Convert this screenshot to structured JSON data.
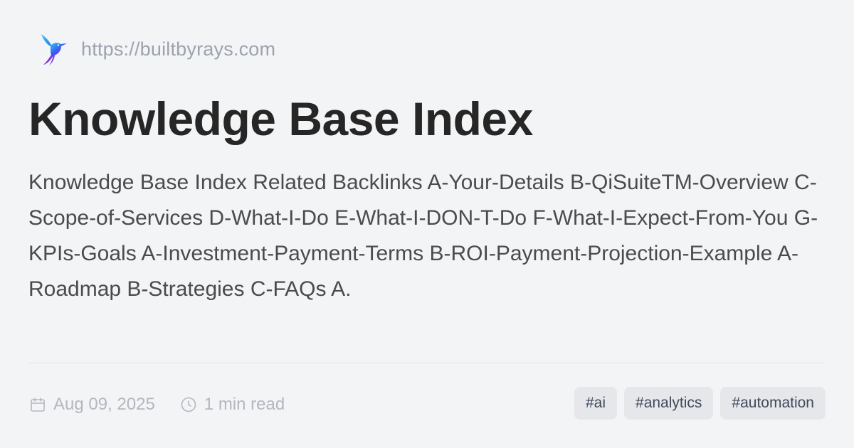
{
  "site": {
    "logo_icon": "hummingbird-logo-icon",
    "url": "https://builtbyrays.com"
  },
  "post": {
    "title": "Knowledge Base Index",
    "description": "Knowledge Base Index Related Backlinks A-Your-Details B-QiSuiteTM-Overview C-Scope-of-Services D-What-I-Do E-What-I-DON-T-Do F-What-I-Expect-From-You G-KPIs-Goals A-Investment-Payment-Terms B-ROI-Payment-Projection-Example A-Roadmap B-Strategies C-FAQs A.",
    "date": "Aug 09, 2025",
    "date_icon": "calendar-icon",
    "read_time": "1 min read",
    "read_time_icon": "clock-icon"
  },
  "tags": [
    "#ai",
    "#analytics",
    "#automation"
  ],
  "colors": {
    "background": "#f3f4f6",
    "title": "#262626",
    "description": "#4b4b4b",
    "muted": "#9ca3af",
    "tag_bg": "#e5e7eb",
    "tag_text": "#3f4a5a"
  }
}
